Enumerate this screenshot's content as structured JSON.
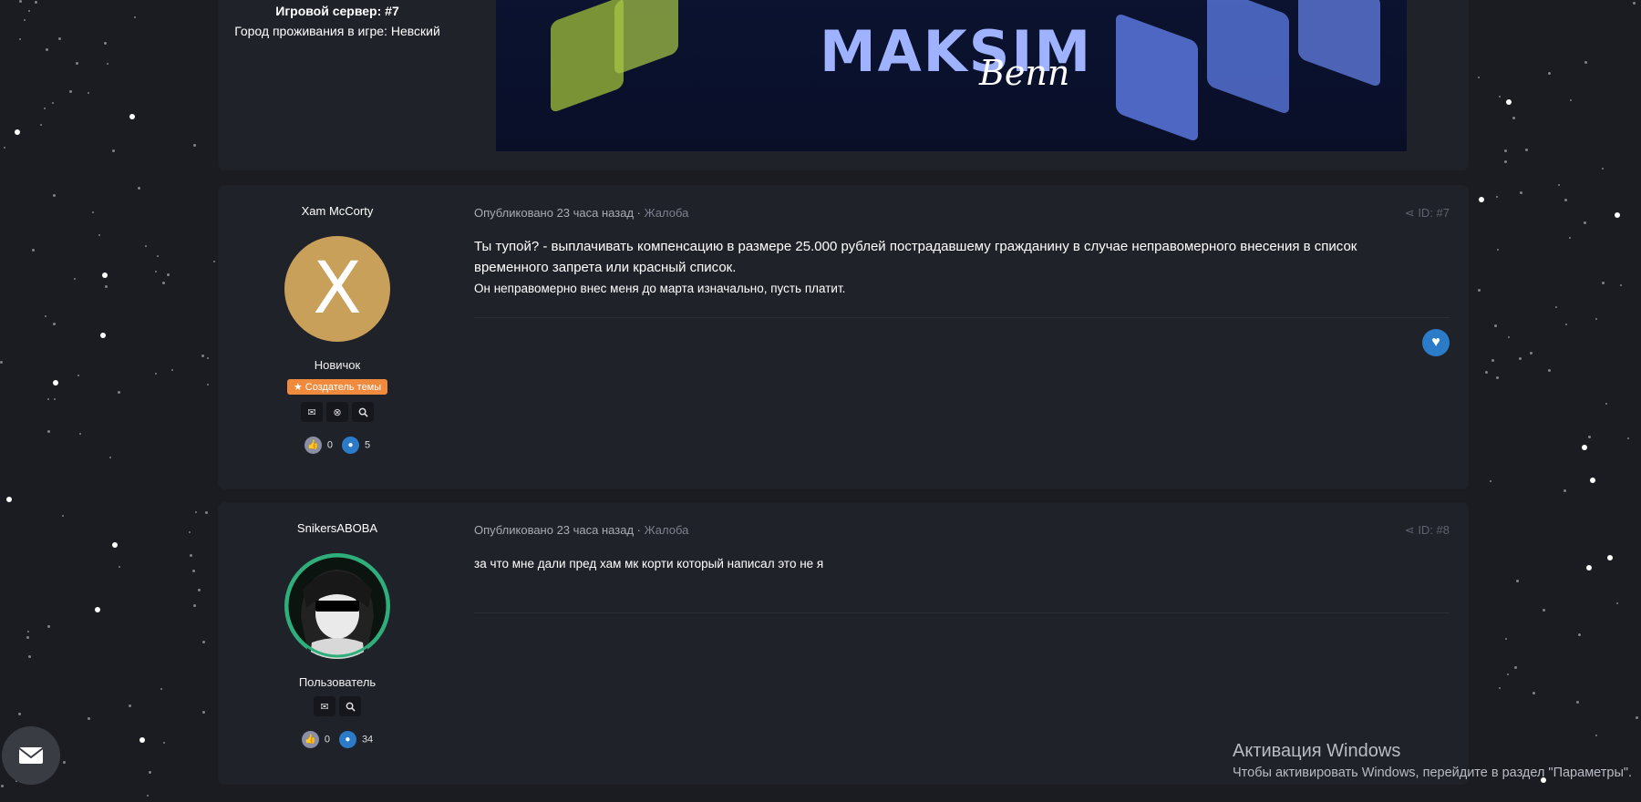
{
  "post_top": {
    "author_line_1": "Игровой сервер: #7",
    "author_line_2": "Город проживания в игре: Невский",
    "banner_title": "MAKSIM",
    "banner_subtitle": "Benn"
  },
  "posts": [
    {
      "author": "Xam McCorty",
      "avatar_letter": "X",
      "rank": "Новичок",
      "badge": "★ Создатель темы",
      "likes": "0",
      "messages": "5",
      "meta": "Опубликовано 23 часа назад",
      "report": "Жалоба",
      "post_id": "ID: #7",
      "text_line_1": "Ты тупой? - выплачивать компенсацию в размере 25.000 рублей пострадавшему гражданину в случае неправомерного внесения в список временного запрета или красный список.",
      "text_line_2": "Он неправомерно внес меня до марта изначально, пусть платит."
    },
    {
      "author": "SnikersABOBA",
      "rank": "Пользователь",
      "likes": "0",
      "messages": "34",
      "meta": "Опубликовано 23 часа назад",
      "report": "Жалоба",
      "post_id": "ID: #8",
      "text_line_1": "за что мне дали пред хам мк корти который написал это не я"
    }
  ],
  "windows_activation": {
    "title": "Активация Windows",
    "subtitle": "Чтобы активировать Windows, перейдите в раздел \"Параметры\"."
  },
  "colors": {
    "background": "#1a1c22",
    "panel": "#202229",
    "badge_orange": "#f08a3c",
    "like_blue": "#2b7bc9",
    "avatar_gold": "#c9a05a"
  }
}
